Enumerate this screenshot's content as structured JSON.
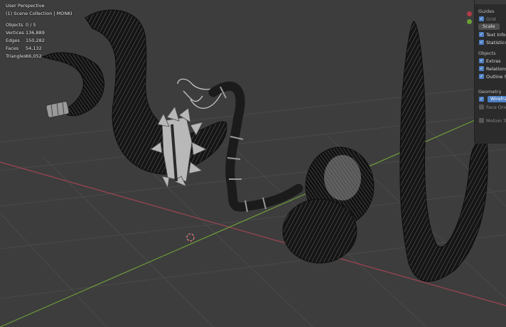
{
  "hud": {
    "title": "User Perspective",
    "subtitle": "(1) Scene Collection | MONKI",
    "stats": [
      {
        "label": "Objects",
        "value": "0 / 5"
      },
      {
        "label": "Vertices",
        "value": "136,889"
      },
      {
        "label": "Edges",
        "value": "150,282"
      },
      {
        "label": "Faces",
        "value": "54,132"
      },
      {
        "label": "Triangles",
        "value": "66,052"
      }
    ]
  },
  "overlays": {
    "guides_label": "Guides",
    "grid_label": "Grid",
    "scale_label": "Scale",
    "text_info_label": "Text Info",
    "statistics_label": "Statistics",
    "objects_label": "Objects",
    "extras_label": "Extras",
    "relationship_label": "Relationship",
    "outline_label": "Outline Sele",
    "geometry_label": "Geometry",
    "wireframe_label": "Wireframe",
    "face_orient_label": "Face Orient",
    "motion_label": "Motion Trac"
  },
  "colors": {
    "background": "#3d3d3d",
    "x_axis": "#a14552",
    "y_axis": "#6e9a3a",
    "accent": "#4d7fc4"
  }
}
